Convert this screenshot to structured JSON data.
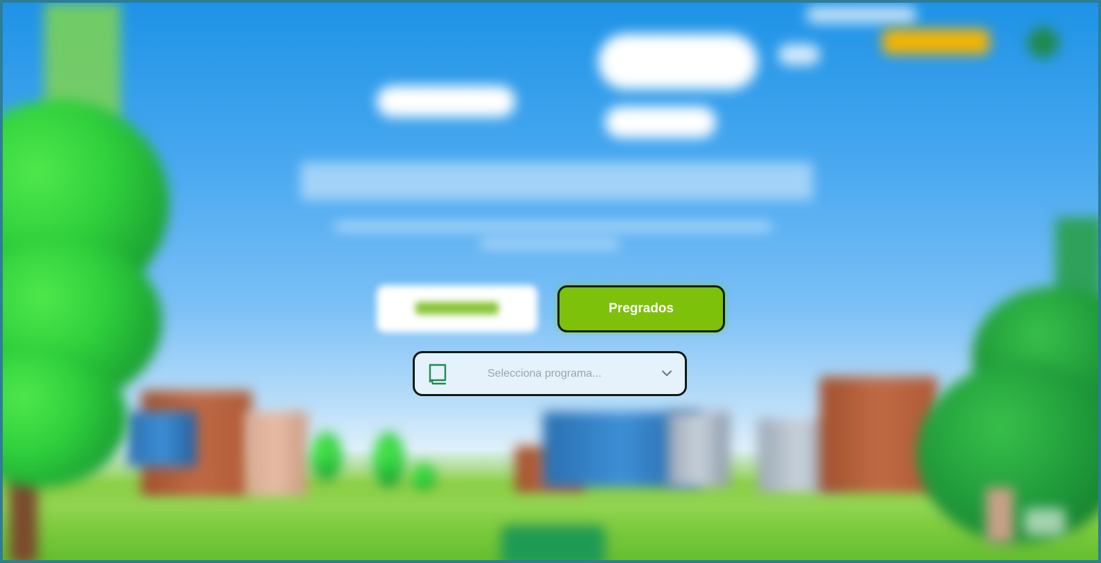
{
  "program_buttons": {
    "secondary_label": "",
    "primary_label": "Pregrados"
  },
  "program_select": {
    "placeholder": "Selecciona programa..."
  },
  "icons": {
    "select_icon": "book-icon",
    "select_chevron": "chevron-down-icon"
  },
  "colors": {
    "primary_green": "#7dc10a",
    "icon_green": "#1f8a4c",
    "border_dark": "#0e1a10"
  }
}
